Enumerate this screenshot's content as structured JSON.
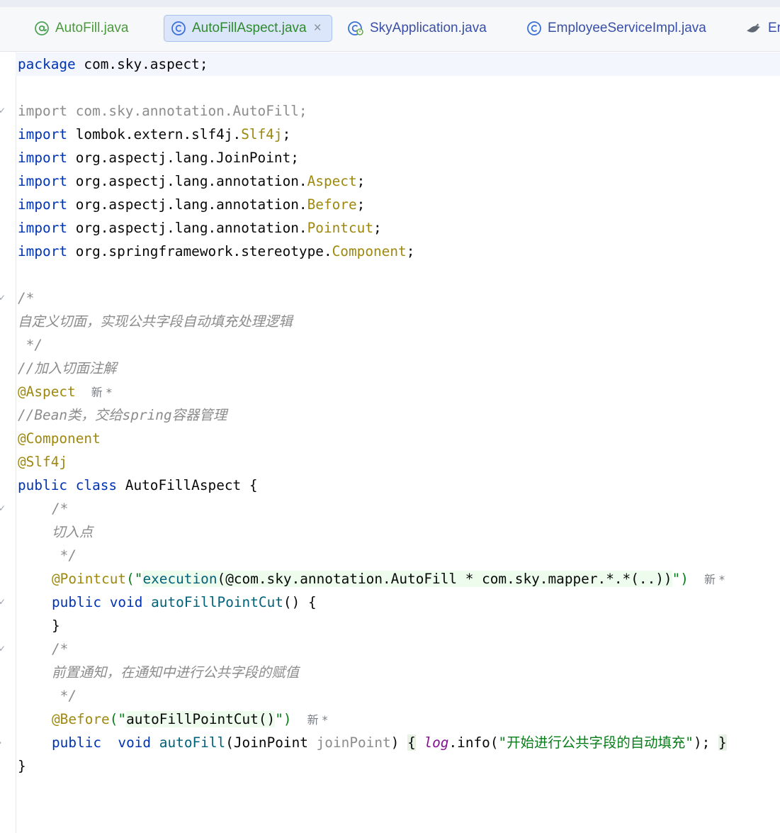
{
  "tabs": [
    {
      "label": "AutoFill.java",
      "icon": "annotation-icon",
      "active": false
    },
    {
      "label": "AutoFillAspect.java",
      "icon": "class-icon",
      "active": true
    },
    {
      "label": "SkyApplication.java",
      "icon": "spring-boot-class-icon",
      "active": false
    },
    {
      "label": "EmployeeServiceImpl.java",
      "icon": "class-icon",
      "active": false
    },
    {
      "label": "Er",
      "icon": "bird-icon",
      "active": false
    }
  ],
  "tab_close_glyph": "×",
  "code": {
    "l1_kw": "package",
    "l1_rest": " com.sky.aspect;",
    "l3_kw": "import",
    "l3_rest": " com.sky.annotation.AutoFill;",
    "l4_kw": "import",
    "l4_a": " lombok.extern.slf4j.",
    "l4_b": "Slf4j",
    "l4_c": ";",
    "l5_kw": "import",
    "l5_rest": " org.aspectj.lang.JoinPoint;",
    "l6_kw": "import",
    "l6_a": " org.aspectj.lang.annotation.",
    "l6_b": "Aspect",
    "l6_c": ";",
    "l7_kw": "import",
    "l7_a": " org.aspectj.lang.annotation.",
    "l7_b": "Before",
    "l7_c": ";",
    "l8_kw": "import",
    "l8_a": " org.aspectj.lang.annotation.",
    "l8_b": "Pointcut",
    "l8_c": ";",
    "l9_kw": "import",
    "l9_a": " org.springframework.stereotype.",
    "l9_b": "Component",
    "l9_c": ";",
    "l11": "/*",
    "l12": "自定义切面，实现公共字段自动填充处理逻辑",
    "l13": " */",
    "l14": "//加入切面注解",
    "l15": "@Aspect",
    "l15_hint": "新 *",
    "l16": "//Bean类，交给spring容器管理",
    "l17": "@Component",
    "l18": "@Slf4j",
    "l19_kw1": "public",
    "l19_kw2": "class",
    "l19_name": " AutoFillAspect {",
    "l20": "/*",
    "l21": "切入点",
    "l22": " */",
    "l23_ann": "@Pointcut",
    "l23_open": "(\"",
    "l23_s1": "execution",
    "l23_s2": "(@com.sky.annotation.AutoFill * com.sky.mapper.*.*(..))",
    "l23_close": "\")",
    "l23_hint": "新 *",
    "l24_kw1": "public",
    "l24_kw2": "void",
    "l24_fn": "autoFillPointCut",
    "l24_rest": "() {",
    "l25": "}",
    "l26": "/*",
    "l27": "前置通知，在通知中进行公共字段的赋值",
    "l28": " */",
    "l29_ann": "@Before",
    "l29_open": "(\"",
    "l29_str": "autoFillPointCut()",
    "l29_close": "\")",
    "l29_hint": "新 *",
    "l30_kw1": "public",
    "l30_kw2": "void",
    "l30_fn": "autoFill",
    "l30_p1": "(JoinPoint ",
    "l30_p2": "joinPoint",
    "l30_p3": ")",
    "l30_lb": "{",
    "l30_log": "log",
    "l30_call": ".info(",
    "l30_str": "\"开始进行公共字段的自动填充\"",
    "l30_end": ");",
    "l30_rb": "}",
    "l31": "}"
  }
}
